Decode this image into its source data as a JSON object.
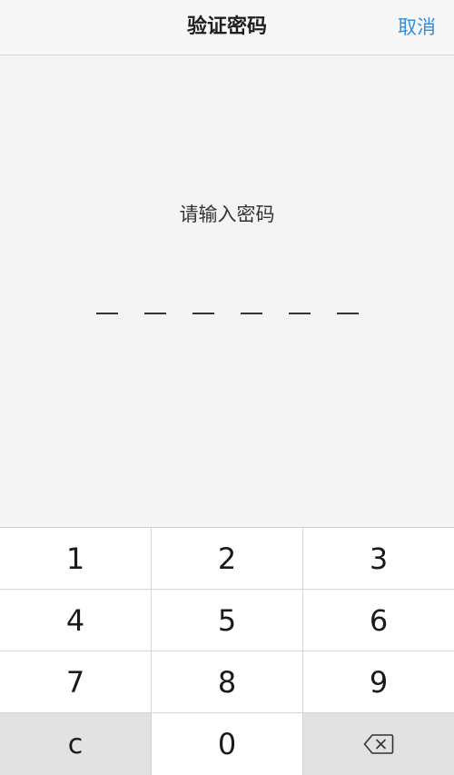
{
  "navbar": {
    "title": "验证密码",
    "cancel_label": "取消"
  },
  "prompt": {
    "text": "请输入密码",
    "digits_total": 6,
    "digits_entered": 0
  },
  "keypad": {
    "keys": [
      "1",
      "2",
      "3",
      "4",
      "5",
      "6",
      "7",
      "8",
      "9",
      "c",
      "0"
    ],
    "delete_icon": "backspace-icon"
  },
  "colors": {
    "accent": "#2f8fe0",
    "background": "#f4f4f4",
    "key_gray": "#e2e2e2"
  }
}
